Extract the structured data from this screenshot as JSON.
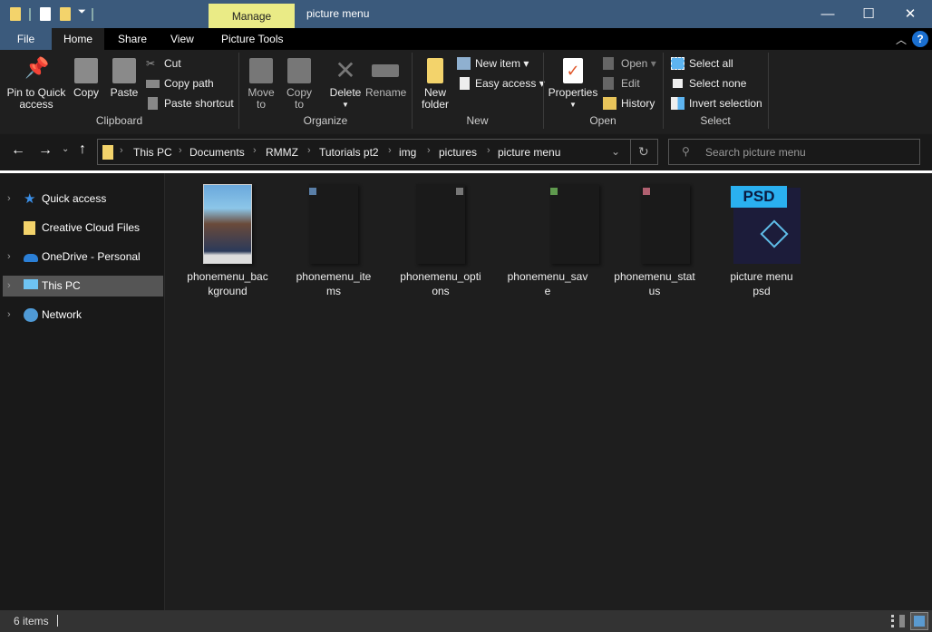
{
  "window": {
    "title": "picture menu",
    "context_tab": "Manage",
    "minimize": "—",
    "maximize": "☐",
    "close": "✕"
  },
  "tabs": [
    "File",
    "Home",
    "Share",
    "View",
    "Picture Tools"
  ],
  "ribbon": {
    "clipboard": {
      "label": "Clipboard",
      "pin": "Pin to Quick access",
      "pin1": "Pin to Quick",
      "pin2": "access",
      "copy": "Copy",
      "paste": "Paste",
      "cut": "Cut",
      "copy_path": "Copy path",
      "paste_shortcut": "Paste shortcut"
    },
    "organize": {
      "label": "Organize",
      "move1": "Move",
      "move2": "to",
      "copy1": "Copy",
      "copy2": "to",
      "delete": "Delete",
      "rename": "Rename"
    },
    "new": {
      "label": "New",
      "folder1": "New",
      "folder2": "folder",
      "new_item": "New item",
      "easy_access": "Easy access"
    },
    "open": {
      "label": "Open",
      "properties": "Properties",
      "open": "Open",
      "edit": "Edit",
      "history": "History"
    },
    "select": {
      "label": "Select",
      "all": "Select all",
      "none": "Select none",
      "invert": "Invert selection"
    }
  },
  "address": {
    "crumbs": [
      "This PC",
      "Documents",
      "RMMZ",
      "Tutorials pt2",
      "img",
      "pictures",
      "picture menu"
    ]
  },
  "search": {
    "placeholder": "Search picture menu"
  },
  "nav": [
    {
      "label": "Quick access",
      "icon": "star-icon"
    },
    {
      "label": "Creative Cloud Files",
      "icon": "creative-cloud-icon"
    },
    {
      "label": "OneDrive - Personal",
      "icon": "cloud-icon"
    },
    {
      "label": "This PC",
      "icon": "computer-icon",
      "selected": true
    },
    {
      "label": "Network",
      "icon": "network-icon"
    }
  ],
  "files": [
    {
      "name": "phonemenu_background",
      "line1": "phonemenu_bac",
      "line2": "kground"
    },
    {
      "name": "phonemenu_items",
      "line1": "phonemenu_ite",
      "line2": "ms",
      "dot": "#5a7fa8"
    },
    {
      "name": "phonemenu_options",
      "line1": "phonemenu_opti",
      "line2": "ons",
      "dot": "#777777"
    },
    {
      "name": "phonemenu_save",
      "line1": "phonemenu_sav",
      "line2": "e",
      "dot": "#5f9a4e"
    },
    {
      "name": "phonemenu_status",
      "line1": "phonemenu_stat",
      "line2": "us",
      "dot": "#b06070"
    },
    {
      "name": "picture menu psd",
      "line1": "picture menu",
      "line2": "psd",
      "badge": "PSD"
    }
  ],
  "status": {
    "count": "6 items"
  }
}
